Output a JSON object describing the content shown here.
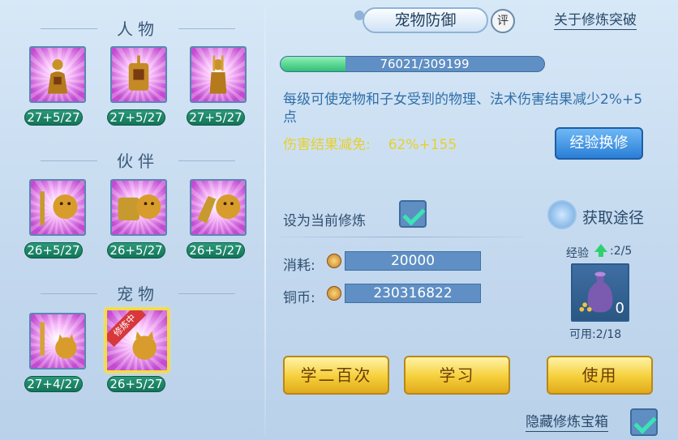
{
  "left": {
    "sections": [
      {
        "title": "人物",
        "items": [
          {
            "level": "27+5/27"
          },
          {
            "level": "27+5/27"
          },
          {
            "level": "27+5/27"
          }
        ]
      },
      {
        "title": "伙伴",
        "items": [
          {
            "level": "26+5/27"
          },
          {
            "level": "26+5/27"
          },
          {
            "level": "26+5/27"
          }
        ]
      },
      {
        "title": "宠物",
        "items": [
          {
            "level": "27+4/27"
          },
          {
            "level": "26+5/27",
            "badge": "修炼中"
          }
        ]
      }
    ]
  },
  "header": {
    "tab_title": "宠物防御",
    "rate_label": "评",
    "about_link": "关于修炼突破"
  },
  "progress": {
    "text": "76021/309199",
    "current": 76021,
    "max": 309199
  },
  "description": "每级可使宠物和子女受到的物理、法术伤害结果减少2%+5点",
  "damage": {
    "label": "伤害结果减免:",
    "value": "62%+155"
  },
  "exp_exchange_button": "经验换修",
  "set_current": {
    "label": "设为当前修炼",
    "checked": true
  },
  "get_path": {
    "label": "获取途径"
  },
  "cost": {
    "label": "消耗:",
    "value": "20000"
  },
  "copper": {
    "label": "铜币:",
    "value": "230316822"
  },
  "exp": {
    "label": "经验",
    "value": ":2/5"
  },
  "item": {
    "count": "0",
    "available": "可用:2/18"
  },
  "buttons": {
    "learn200": "学二百次",
    "learn": "学习",
    "use": "使用"
  },
  "hide_chest": {
    "label": "隐藏修炼宝箱",
    "checked": true
  }
}
